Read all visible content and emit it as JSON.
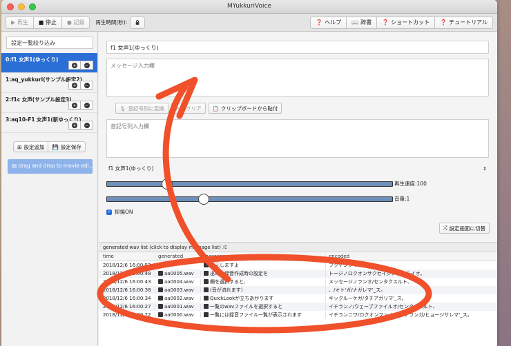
{
  "window": {
    "title": "MYukkuriVoice"
  },
  "toolbar": {
    "play_label": "▶ 再生",
    "stop_label": "■ 停止",
    "record_label": "● 記録",
    "time_label": "再生時間(秒):",
    "help_label": "ヘルプ",
    "dict_label": "辞書",
    "shortcut_label": "ショートカット",
    "tutorial_label": "チュートリアル"
  },
  "sidebar": {
    "filter_placeholder": "設定一覧絞り込み",
    "items": [
      {
        "label": "0:f1 女声1(ゆっくり)"
      },
      {
        "label": "1:aq_yukkuri(サンプル設定2)"
      },
      {
        "label": "2:f1c 女声(サンプル設定3)"
      },
      {
        "label": "3:aq10-F1 女声1(新ゆっくり)"
      }
    ],
    "add_label": "設定追加",
    "save_label": "設定保存",
    "drag_label": "drag and drop to movie edi..."
  },
  "main": {
    "name_value": "f1 女声1(ゆっくり)",
    "message_placeholder": "メッセージ入力欄",
    "convert_label": "音記号列に変換",
    "clear_label": "入力クリア",
    "paste_label": "クリップボードから貼付",
    "encoded_placeholder": "音記号列入力欄",
    "voice_select": "f1 女声1(ゆっくり)",
    "speed_label": "再生速度:100",
    "speed_value": 0.21,
    "volume_label": "音量:1",
    "volume_value": 0.34,
    "inflection_label": "抑揚ON",
    "switch_label": "設定画面に切替"
  },
  "list": {
    "title": "generated wav list (click to display message list)",
    "columns": [
      "time",
      "generated",
      "message",
      "encoded"
    ],
    "rows": [
      {
        "time": "2018/12/6 16:00:52",
        "file": "",
        "message": "復元しますよ",
        "encoded": "フクゲンシマスヨ"
      },
      {
        "time": "2018/12/6 16:00:48",
        "file": "aa0005.wav",
        "message": "出時の録音作成時の設定を",
        "encoded": "トージノロクオンサクセイジノセッテイオ。"
      },
      {
        "time": "2018/12/6 16:00:43",
        "file": "aa0004.wav",
        "message": "欄を選択すると、",
        "encoded": "メッセージノランオ/センタクスルト、"
      },
      {
        "time": "2018/12/6 16:00:38",
        "file": "aa0003.wav",
        "message": "(音が流れます)",
        "encoded": "、/オト'ガ/ナガレマ'_ス。"
      },
      {
        "time": "2018/12/6 16:00:34",
        "file": "aa0002.wav",
        "message": "QuickLookが立ちあがります",
        "encoded": "キックルーケガ/タチアガリマ'_ス。"
      },
      {
        "time": "2018/12/6 16:00:27",
        "file": "aa0001.wav",
        "message": "一覧のwavファイルを選択すると",
        "encoded": "イチランノ/ウェーブファイルオ/センタクスルト、"
      },
      {
        "time": "2018/12/6 16:00:22",
        "file": "aa0000.wav",
        "message": "一覧には録音ファイル一覧が表示されます",
        "encoded": "イチランニワ/ロクオンファイルイ'チランガ/ヒョージサレマ'_ス。"
      }
    ]
  },
  "colors": {
    "accent": "#2a6fd6",
    "annotation": "#f0502a"
  }
}
